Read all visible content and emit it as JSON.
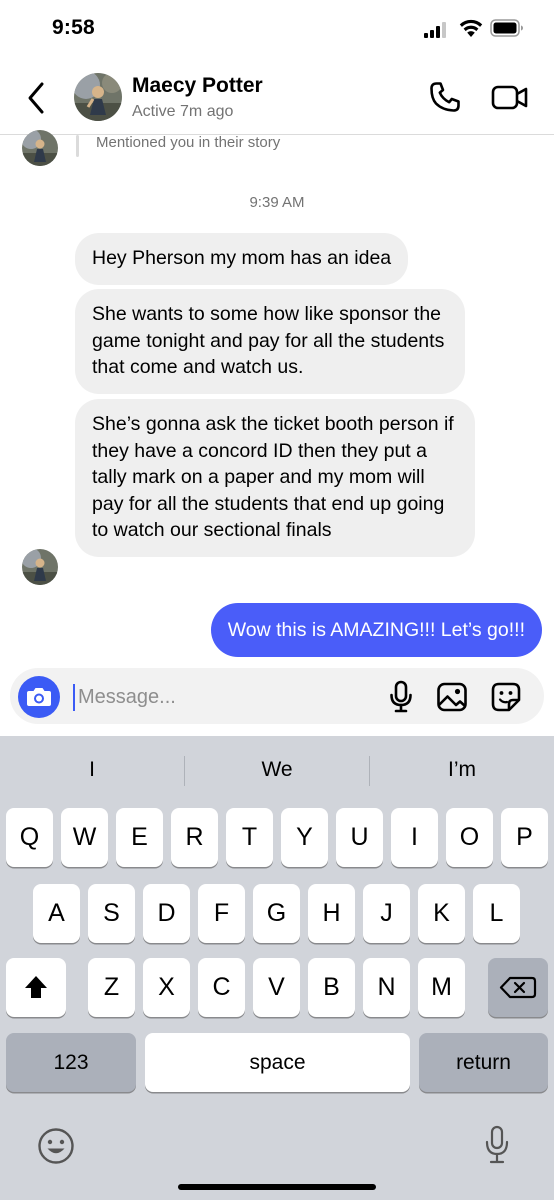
{
  "status_bar": {
    "time": "9:58"
  },
  "header": {
    "contact_name": "Maecy Potter",
    "contact_status": "Active 7m ago",
    "icons": [
      "back-chevron-icon",
      "phone-icon",
      "video-camera-icon"
    ]
  },
  "chat": {
    "story_reply_text": "Mentioned you in their story",
    "timestamp": "9:39 AM",
    "incoming_messages": [
      "Hey Pherson my mom has an idea",
      "She wants to some how like sponsor the game tonight and pay for all the students that come and watch us.",
      "She’s gonna ask the ticket booth person if they have a concord ID then they put a tally mark on a paper and my mom will pay for all the students that end up going to watch our sectional finals"
    ],
    "outgoing_messages": [
      "Wow this is AMAZING!!! Let’s go!!!"
    ]
  },
  "composer": {
    "placeholder": "Message...",
    "value": "",
    "accent_color": "#3b5bf5"
  },
  "keyboard": {
    "suggestions": [
      "I",
      "We",
      "I’m"
    ],
    "row1": [
      "Q",
      "W",
      "E",
      "R",
      "T",
      "Y",
      "U",
      "I",
      "O",
      "P"
    ],
    "row2": [
      "A",
      "S",
      "D",
      "F",
      "G",
      "H",
      "J",
      "K",
      "L"
    ],
    "row3": [
      "Z",
      "X",
      "C",
      "V",
      "B",
      "N",
      "M"
    ],
    "numbers_label": "123",
    "space_label": "space",
    "return_label": "return"
  },
  "colors": {
    "outgoing_bubble": "#4a5df9",
    "incoming_bubble": "#efefef",
    "secondary_text": "#737373"
  }
}
